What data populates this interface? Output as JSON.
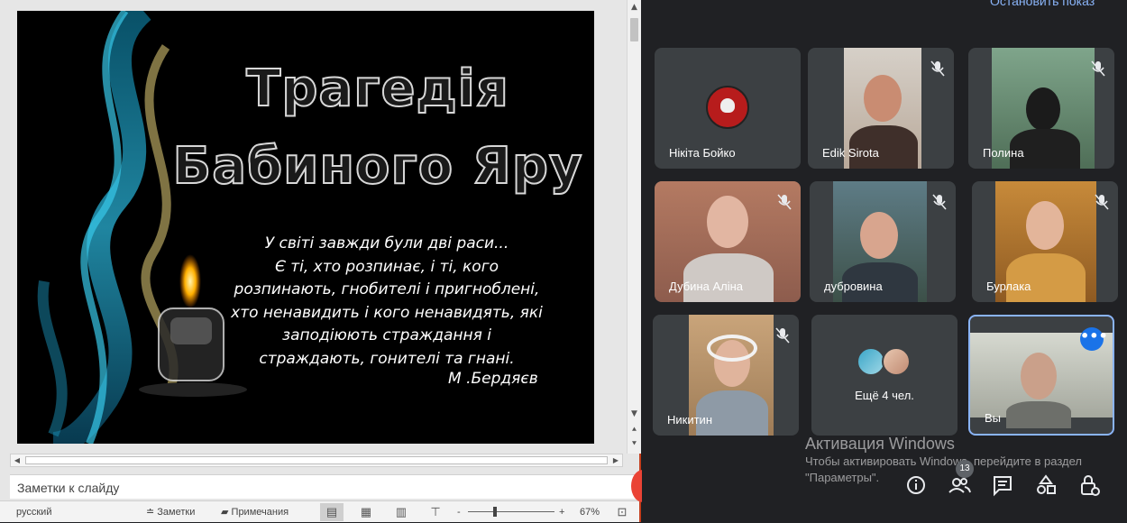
{
  "powerpoint": {
    "slide": {
      "title_lines": [
        "Трагедія",
        "Бабиного Яру"
      ],
      "quote_lines": [
        "У світі завжди були дві раси...",
        "Є ті, хто розпинає, і ті, кого",
        "розпинають, гнобителі і пригноблені,",
        "хто ненавидить і кого ненавидять, які",
        "заподіюють страждання і",
        "страждають, гонителі та гнані."
      ],
      "author": "М .Бердяєв"
    },
    "notes_placeholder": "Заметки к слайду",
    "status": {
      "language": "русский",
      "notes_label": "Заметки",
      "comments_label": "Примечания",
      "zoom_minus": "-",
      "zoom_plus": "+",
      "zoom_level": "67%"
    }
  },
  "meet": {
    "stop_presenting": "Остановить показ",
    "participants": [
      {
        "name": "Нікіта Бойко",
        "muted": false
      },
      {
        "name": "Edik Sirota",
        "muted": true
      },
      {
        "name": "Полина",
        "muted": true
      },
      {
        "name": "Дубина Аліна",
        "muted": true
      },
      {
        "name": "дубровина",
        "muted": true
      },
      {
        "name": "Бурлака",
        "muted": true
      },
      {
        "name": "Никитин",
        "muted": true
      },
      {
        "name": "Ещё 4 чел.",
        "muted": false
      },
      {
        "name": "Вы",
        "muted": false
      }
    ],
    "people_count": "13",
    "colors": {
      "accent": "#8ab4f8",
      "tile": "#3c4043",
      "background": "#202124",
      "self_button": "#1a73e8"
    }
  },
  "windows_activation": {
    "heading": "Активация Windows",
    "text": "Чтобы активировать Windows, перейдите в раздел \"Параметры\"."
  }
}
